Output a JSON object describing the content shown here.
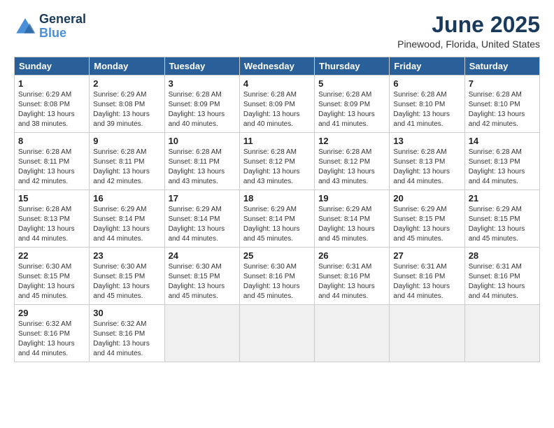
{
  "logo": {
    "line1": "General",
    "line2": "Blue"
  },
  "title": "June 2025",
  "subtitle": "Pinewood, Florida, United States",
  "weekdays": [
    "Sunday",
    "Monday",
    "Tuesday",
    "Wednesday",
    "Thursday",
    "Friday",
    "Saturday"
  ],
  "weeks": [
    [
      {
        "day": "1",
        "sunrise": "6:29 AM",
        "sunset": "8:08 PM",
        "daylight": "13 hours and 38 minutes."
      },
      {
        "day": "2",
        "sunrise": "6:29 AM",
        "sunset": "8:08 PM",
        "daylight": "13 hours and 39 minutes."
      },
      {
        "day": "3",
        "sunrise": "6:28 AM",
        "sunset": "8:09 PM",
        "daylight": "13 hours and 40 minutes."
      },
      {
        "day": "4",
        "sunrise": "6:28 AM",
        "sunset": "8:09 PM",
        "daylight": "13 hours and 40 minutes."
      },
      {
        "day": "5",
        "sunrise": "6:28 AM",
        "sunset": "8:09 PM",
        "daylight": "13 hours and 41 minutes."
      },
      {
        "day": "6",
        "sunrise": "6:28 AM",
        "sunset": "8:10 PM",
        "daylight": "13 hours and 41 minutes."
      },
      {
        "day": "7",
        "sunrise": "6:28 AM",
        "sunset": "8:10 PM",
        "daylight": "13 hours and 42 minutes."
      }
    ],
    [
      {
        "day": "8",
        "sunrise": "6:28 AM",
        "sunset": "8:11 PM",
        "daylight": "13 hours and 42 minutes."
      },
      {
        "day": "9",
        "sunrise": "6:28 AM",
        "sunset": "8:11 PM",
        "daylight": "13 hours and 42 minutes."
      },
      {
        "day": "10",
        "sunrise": "6:28 AM",
        "sunset": "8:11 PM",
        "daylight": "13 hours and 43 minutes."
      },
      {
        "day": "11",
        "sunrise": "6:28 AM",
        "sunset": "8:12 PM",
        "daylight": "13 hours and 43 minutes."
      },
      {
        "day": "12",
        "sunrise": "6:28 AM",
        "sunset": "8:12 PM",
        "daylight": "13 hours and 43 minutes."
      },
      {
        "day": "13",
        "sunrise": "6:28 AM",
        "sunset": "8:13 PM",
        "daylight": "13 hours and 44 minutes."
      },
      {
        "day": "14",
        "sunrise": "6:28 AM",
        "sunset": "8:13 PM",
        "daylight": "13 hours and 44 minutes."
      }
    ],
    [
      {
        "day": "15",
        "sunrise": "6:28 AM",
        "sunset": "8:13 PM",
        "daylight": "13 hours and 44 minutes."
      },
      {
        "day": "16",
        "sunrise": "6:29 AM",
        "sunset": "8:14 PM",
        "daylight": "13 hours and 44 minutes."
      },
      {
        "day": "17",
        "sunrise": "6:29 AM",
        "sunset": "8:14 PM",
        "daylight": "13 hours and 44 minutes."
      },
      {
        "day": "18",
        "sunrise": "6:29 AM",
        "sunset": "8:14 PM",
        "daylight": "13 hours and 45 minutes."
      },
      {
        "day": "19",
        "sunrise": "6:29 AM",
        "sunset": "8:14 PM",
        "daylight": "13 hours and 45 minutes."
      },
      {
        "day": "20",
        "sunrise": "6:29 AM",
        "sunset": "8:15 PM",
        "daylight": "13 hours and 45 minutes."
      },
      {
        "day": "21",
        "sunrise": "6:29 AM",
        "sunset": "8:15 PM",
        "daylight": "13 hours and 45 minutes."
      }
    ],
    [
      {
        "day": "22",
        "sunrise": "6:30 AM",
        "sunset": "8:15 PM",
        "daylight": "13 hours and 45 minutes."
      },
      {
        "day": "23",
        "sunrise": "6:30 AM",
        "sunset": "8:15 PM",
        "daylight": "13 hours and 45 minutes."
      },
      {
        "day": "24",
        "sunrise": "6:30 AM",
        "sunset": "8:15 PM",
        "daylight": "13 hours and 45 minutes."
      },
      {
        "day": "25",
        "sunrise": "6:30 AM",
        "sunset": "8:16 PM",
        "daylight": "13 hours and 45 minutes."
      },
      {
        "day": "26",
        "sunrise": "6:31 AM",
        "sunset": "8:16 PM",
        "daylight": "13 hours and 44 minutes."
      },
      {
        "day": "27",
        "sunrise": "6:31 AM",
        "sunset": "8:16 PM",
        "daylight": "13 hours and 44 minutes."
      },
      {
        "day": "28",
        "sunrise": "6:31 AM",
        "sunset": "8:16 PM",
        "daylight": "13 hours and 44 minutes."
      }
    ],
    [
      {
        "day": "29",
        "sunrise": "6:32 AM",
        "sunset": "8:16 PM",
        "daylight": "13 hours and 44 minutes."
      },
      {
        "day": "30",
        "sunrise": "6:32 AM",
        "sunset": "8:16 PM",
        "daylight": "13 hours and 44 minutes."
      },
      null,
      null,
      null,
      null,
      null
    ]
  ],
  "labels": {
    "sunrise": "Sunrise:",
    "sunset": "Sunset:",
    "daylight": "Daylight:"
  }
}
